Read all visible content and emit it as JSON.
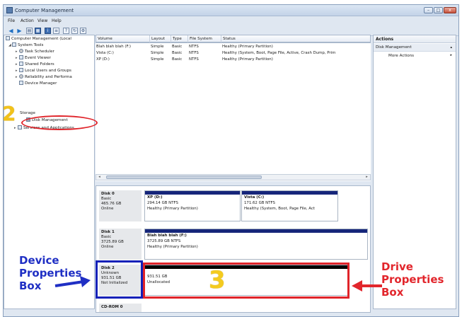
{
  "window": {
    "title": "Computer Management"
  },
  "menu": [
    "File",
    "Action",
    "View",
    "Help"
  ],
  "tree": [
    {
      "label": "Computer Management (Local",
      "depth": 0,
      "icon": "computer-icon"
    },
    {
      "label": "System Tools",
      "depth": 1,
      "icon": "tools-icon"
    },
    {
      "label": "Task Scheduler",
      "depth": 2,
      "icon": "clock-icon"
    },
    {
      "label": "Event Viewer",
      "depth": 2,
      "icon": "event-icon"
    },
    {
      "label": "Shared Folders",
      "depth": 2,
      "icon": "folder-icon"
    },
    {
      "label": "Local Users and Groups",
      "depth": 2,
      "icon": "users-icon"
    },
    {
      "label": "Reliability and Performa",
      "depth": 2,
      "icon": "gauge-icon"
    },
    {
      "label": "Device Manager",
      "depth": 2,
      "icon": "device-icon"
    },
    {
      "label": "Storage",
      "depth": 1,
      "icon": "storage-icon"
    },
    {
      "label": "Disk Management",
      "depth": 2,
      "icon": "disk-icon"
    },
    {
      "label": "Services and Applications",
      "depth": 1,
      "icon": "services-icon"
    }
  ],
  "table": {
    "columns": [
      "Volume",
      "Layout",
      "Type",
      "File System",
      "Status"
    ],
    "rows": [
      [
        "Blah blah blah (F:)",
        "Simple",
        "Basic",
        "NTFS",
        "Healthy (Primary Partition)"
      ],
      [
        "Vista (C:)",
        "Simple",
        "Basic",
        "NTFS",
        "Healthy (System, Boot, Page File, Active, Crash Dump, Prim"
      ],
      [
        "XP (D:)",
        "Simple",
        "Basic",
        "NTFS",
        "Healthy (Primary Partition)"
      ]
    ]
  },
  "disks": [
    {
      "name": "Disk 0",
      "type": "Basic",
      "size": "465.76 GB",
      "state": "Online",
      "volumes": [
        {
          "name": "XP (D:)",
          "size": "294.14 GB NTFS",
          "status": "Healthy (Primary Partition)"
        },
        {
          "name": "Vista (C:)",
          "size": "171.62 GB NTFS",
          "status": "Healthy (System, Boot, Page File, Act"
        }
      ]
    },
    {
      "name": "Disk 1",
      "type": "Basic",
      "size": "3725.89 GB",
      "state": "Online",
      "volumes": [
        {
          "name": "Blah blah blah (F:)",
          "size": "3725.89 GB NTFS",
          "status": "Healthy (Primary Partition)"
        }
      ]
    },
    {
      "name": "Disk 2",
      "type": "Unknown",
      "size": "931.51 GB",
      "state": "Not Initialized",
      "volumes": [
        {
          "name": "",
          "size": "931.51 GB",
          "status": "Unallocated"
        }
      ]
    },
    {
      "name": "CD-ROM 0",
      "type": "",
      "size": "",
      "state": ""
    }
  ],
  "actions": {
    "header": "Actions",
    "section": "Disk Management",
    "item": "More Actions"
  },
  "annotations": {
    "num2": "2",
    "num3": "3",
    "device_box": "Device Properties Box",
    "drive_box": "Drive Properties Box"
  },
  "colors": {
    "primary_partition": "#16267a",
    "unallocated": "#000000",
    "annot_red": "#e0242a",
    "annot_blue": "#1421b8",
    "annot_yellow": "#f2c21a"
  }
}
